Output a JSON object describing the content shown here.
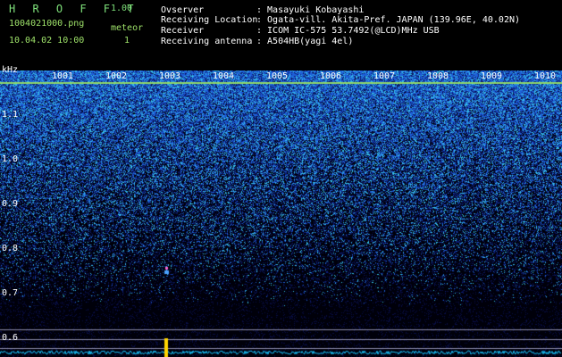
{
  "header": {
    "title": "H R O F F T",
    "version": "1.00",
    "filename": "1004021000.png",
    "datetime": "10.04.02 10:00",
    "meteor_label": "meteor",
    "meteor_count": "1"
  },
  "info": {
    "observer_label": "Ovserver",
    "observer_value": ": Masayuki Kobayashi",
    "location_label": "Receiving Location",
    "location_value": ": Ogata-vill. Akita-Pref. JAPAN (139.96E, 40.02N)",
    "receiver_label": "Receiver",
    "receiver_value": ": ICOM IC-575 53.7492(@LCD)MHz USB",
    "antenna_label": "Receiving antenna",
    "antenna_value": ": A504HB(yagi 4el)"
  },
  "axis": {
    "unit": "kHz",
    "y_ticks": [
      "1.1",
      "1.0",
      "0.9",
      "0.8",
      "0.7",
      "0.6"
    ],
    "x_ticks": [
      "1001",
      "1002",
      "1003",
      "1004",
      "1005",
      "1006",
      "1007",
      "1008",
      "1009",
      "1010"
    ]
  },
  "colors": {
    "background": "#000000",
    "noise_low": "#0a1a6e",
    "noise_mid": "#1e5fd8",
    "noise_high": "#36c0e8",
    "carrier_line": "#8fd66a",
    "meteor": "#ff5fd2",
    "trace": "#18c6ff",
    "marker": "#ffd400"
  }
}
